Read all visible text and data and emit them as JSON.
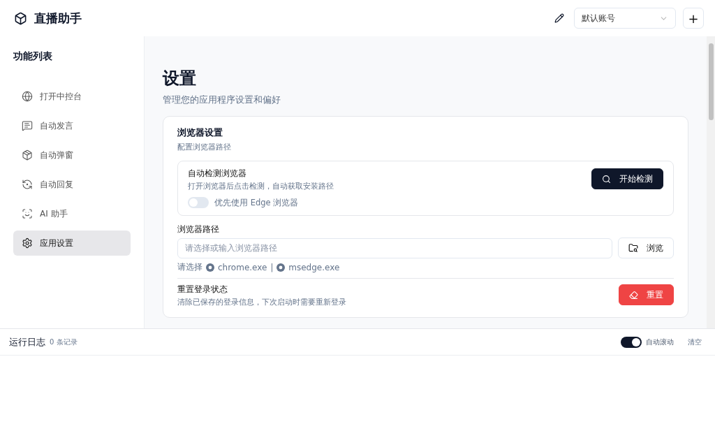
{
  "app": {
    "title": "直播助手"
  },
  "header": {
    "account": {
      "value": "默认账号"
    },
    "add_button": "+"
  },
  "sidebar": {
    "title": "功能列表",
    "items": [
      {
        "label": "打开中控台",
        "selected": false
      },
      {
        "label": "自动发言",
        "selected": false
      },
      {
        "label": "自动弹窗",
        "selected": false
      },
      {
        "label": "自动回复",
        "selected": false
      },
      {
        "label": "AI 助手",
        "selected": false
      },
      {
        "label": "应用设置",
        "selected": true
      }
    ]
  },
  "page": {
    "title": "设置",
    "subtitle": "管理您的应用程序设置和偏好"
  },
  "card": {
    "title": "浏览器设置",
    "subtitle": "配置浏览器路径",
    "detect": {
      "title": "自动检测浏览器",
      "description": "打开浏览器后点击检测，自动获取安装路径",
      "button": "开始检测",
      "toggle": {
        "label": "优先使用 Edge 浏览器",
        "on": false
      }
    },
    "path": {
      "label": "浏览器路径",
      "placeholder": "请选择或输入浏览器路径",
      "button": "浏览",
      "hint": "请选择",
      "options": [
        "chrome.exe",
        "msedge.exe"
      ],
      "separator": "|"
    },
    "reset": {
      "title": "重置登录状态",
      "description": "清除已保存的登录信息，下次启动时需要重新登录",
      "button": "重置"
    }
  },
  "log": {
    "title": "运行日志",
    "count": "0 条记录",
    "auto_scroll": {
      "label": "自动滚动",
      "on": true
    },
    "clear": "清空"
  }
}
